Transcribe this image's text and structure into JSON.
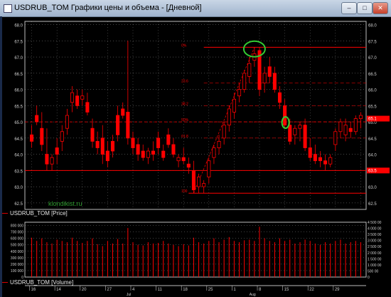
{
  "window": {
    "title": "USDRUB_TOM Графики цены и объема - [Дневной]",
    "controls": [
      "–",
      "□",
      "✕"
    ]
  },
  "price_pane": {
    "legend": "USDRUB_TOM [Price]",
    "watermark": "klondikist.ru",
    "y_ticks": [
      "68.0",
      "67.5",
      "67.0",
      "66.5",
      "66.0",
      "65.5",
      "65.0",
      "64.5",
      "64.0",
      "63.5",
      "63.0",
      "62.5"
    ],
    "fib_labels": [
      "0%",
      "23.6",
      "38.2",
      "50%",
      "61.8",
      "100"
    ],
    "right_labels": {
      "upper": "65.1",
      "lower": "63.5"
    }
  },
  "volume_pane": {
    "legend": "USDRUB_TOM [Volume]",
    "left_ticks": [
      "800 000",
      "700 000",
      "600 000",
      "500 000",
      "400 000",
      "300 000",
      "200 000",
      "100 000",
      "0"
    ],
    "right_ticks": [
      "4 500 00",
      "4 000 00",
      "3 500 00",
      "3 000 00",
      "2 500 00",
      "2 000 00",
      "1 500 00",
      "1 000 00",
      "500 00",
      "0"
    ]
  },
  "time_axis": {
    "days": [
      "16",
      "14",
      "20",
      "27",
      "4",
      "11",
      "18",
      "25",
      "1",
      "8",
      "15",
      "22",
      "29"
    ],
    "months": [
      "Jul",
      "Aug"
    ]
  },
  "colors": {
    "candle": "#ff0000",
    "grid": "#ffffff",
    "axis": "#cfcfcf",
    "highlight_circle": "#33cc33",
    "background": "#000000"
  },
  "chart_data": {
    "type": "candlestick",
    "ylim": [
      62.3,
      68.1
    ],
    "candles": [
      {
        "o": 64.6,
        "h": 64.9,
        "l": 64.2,
        "c": 64.4
      },
      {
        "o": 65.2,
        "h": 65.5,
        "l": 64.9,
        "c": 65.0
      },
      {
        "o": 64.8,
        "h": 65.3,
        "l": 64.1,
        "c": 64.3
      },
      {
        "o": 64.0,
        "h": 64.8,
        "l": 63.5,
        "c": 63.7
      },
      {
        "o": 63.7,
        "h": 64.0,
        "l": 63.5,
        "c": 63.9
      },
      {
        "o": 64.2,
        "h": 64.5,
        "l": 63.7,
        "c": 64.0
      },
      {
        "o": 64.4,
        "h": 64.9,
        "l": 64.1,
        "c": 64.7
      },
      {
        "o": 64.8,
        "h": 65.4,
        "l": 64.6,
        "c": 65.2
      },
      {
        "o": 65.6,
        "h": 66.1,
        "l": 65.3,
        "c": 65.9
      },
      {
        "o": 65.8,
        "h": 66.0,
        "l": 65.4,
        "c": 65.5
      },
      {
        "o": 65.7,
        "h": 66.0,
        "l": 65.5,
        "c": 65.8
      },
      {
        "o": 65.6,
        "h": 65.9,
        "l": 65.2,
        "c": 65.3
      },
      {
        "o": 64.8,
        "h": 65.1,
        "l": 64.2,
        "c": 64.4
      },
      {
        "o": 64.4,
        "h": 64.7,
        "l": 64.0,
        "c": 64.2
      },
      {
        "o": 64.5,
        "h": 64.9,
        "l": 63.7,
        "c": 64.0
      },
      {
        "o": 64.1,
        "h": 64.4,
        "l": 63.6,
        "c": 63.8
      },
      {
        "o": 64.4,
        "h": 64.6,
        "l": 63.9,
        "c": 64.1
      },
      {
        "o": 65.2,
        "h": 65.5,
        "l": 64.4,
        "c": 64.6
      },
      {
        "o": 65.4,
        "h": 65.6,
        "l": 65.1,
        "c": 65.2
      },
      {
        "o": 65.3,
        "h": 67.5,
        "l": 64.3,
        "c": 64.5
      },
      {
        "o": 64.5,
        "h": 64.7,
        "l": 64.0,
        "c": 64.2
      },
      {
        "o": 64.3,
        "h": 64.5,
        "l": 63.8,
        "c": 64.0
      },
      {
        "o": 64.1,
        "h": 64.3,
        "l": 63.8,
        "c": 63.9
      },
      {
        "o": 63.9,
        "h": 64.2,
        "l": 63.7,
        "c": 64.1
      },
      {
        "o": 64.1,
        "h": 64.4,
        "l": 63.8,
        "c": 64.0
      },
      {
        "o": 64.5,
        "h": 64.7,
        "l": 64.0,
        "c": 64.2
      },
      {
        "o": 64.1,
        "h": 64.3,
        "l": 63.8,
        "c": 63.9
      },
      {
        "o": 64.6,
        "h": 64.8,
        "l": 64.2,
        "c": 64.3
      },
      {
        "o": 64.3,
        "h": 64.5,
        "l": 63.9,
        "c": 64.0
      },
      {
        "o": 63.8,
        "h": 64.0,
        "l": 63.6,
        "c": 63.9
      },
      {
        "o": 63.9,
        "h": 64.2,
        "l": 63.7,
        "c": 63.8
      },
      {
        "o": 63.7,
        "h": 63.9,
        "l": 63.4,
        "c": 63.6
      },
      {
        "o": 63.5,
        "h": 63.8,
        "l": 62.8,
        "c": 62.9
      },
      {
        "o": 63.0,
        "h": 63.4,
        "l": 62.8,
        "c": 63.3
      },
      {
        "o": 63.0,
        "h": 63.2,
        "l": 62.8,
        "c": 63.1
      },
      {
        "o": 63.3,
        "h": 63.9,
        "l": 63.1,
        "c": 63.8
      },
      {
        "o": 63.9,
        "h": 64.3,
        "l": 63.7,
        "c": 64.2
      },
      {
        "o": 64.2,
        "h": 64.6,
        "l": 64.0,
        "c": 64.4
      },
      {
        "o": 64.5,
        "h": 65.0,
        "l": 64.3,
        "c": 64.9
      },
      {
        "o": 64.9,
        "h": 65.5,
        "l": 64.7,
        "c": 65.4
      },
      {
        "o": 65.3,
        "h": 65.9,
        "l": 65.1,
        "c": 65.7
      },
      {
        "o": 65.8,
        "h": 66.2,
        "l": 65.6,
        "c": 66.0
      },
      {
        "o": 66.0,
        "h": 66.6,
        "l": 65.9,
        "c": 66.5
      },
      {
        "o": 66.4,
        "h": 67.0,
        "l": 66.2,
        "c": 66.8
      },
      {
        "o": 66.9,
        "h": 67.3,
        "l": 66.7,
        "c": 67.1
      },
      {
        "o": 67.2,
        "h": 67.3,
        "l": 65.8,
        "c": 66.0
      },
      {
        "o": 66.2,
        "h": 66.7,
        "l": 65.9,
        "c": 66.5
      },
      {
        "o": 66.7,
        "h": 67.0,
        "l": 66.2,
        "c": 66.4
      },
      {
        "o": 66.5,
        "h": 66.7,
        "l": 65.9,
        "c": 66.0
      },
      {
        "o": 65.9,
        "h": 66.1,
        "l": 65.4,
        "c": 65.6
      },
      {
        "o": 65.5,
        "h": 65.7,
        "l": 64.8,
        "c": 64.9
      },
      {
        "o": 64.9,
        "h": 65.1,
        "l": 64.3,
        "c": 64.4
      },
      {
        "o": 64.6,
        "h": 64.9,
        "l": 64.3,
        "c": 64.8
      },
      {
        "o": 64.8,
        "h": 65.0,
        "l": 64.4,
        "c": 64.9
      },
      {
        "o": 64.9,
        "h": 65.1,
        "l": 64.1,
        "c": 64.2
      },
      {
        "o": 64.2,
        "h": 64.5,
        "l": 63.8,
        "c": 63.9
      },
      {
        "o": 64.0,
        "h": 64.3,
        "l": 63.7,
        "c": 63.8
      },
      {
        "o": 63.9,
        "h": 64.1,
        "l": 63.6,
        "c": 63.8
      },
      {
        "o": 63.8,
        "h": 64.0,
        "l": 63.5,
        "c": 63.7
      },
      {
        "o": 63.7,
        "h": 64.0,
        "l": 63.6,
        "c": 63.9
      },
      {
        "o": 64.3,
        "h": 64.8,
        "l": 64.1,
        "c": 64.7
      },
      {
        "o": 64.7,
        "h": 65.1,
        "l": 64.5,
        "c": 65.0
      },
      {
        "o": 64.6,
        "h": 65.1,
        "l": 64.4,
        "c": 64.9
      },
      {
        "o": 64.8,
        "h": 65.0,
        "l": 64.5,
        "c": 64.7
      },
      {
        "o": 64.7,
        "h": 65.2,
        "l": 64.6,
        "c": 65.1
      },
      {
        "o": 65.1,
        "h": 65.3,
        "l": 64.8,
        "c": 65.2
      }
    ],
    "horizontal_levels": [
      67.3,
      65.0,
      63.5,
      62.8
    ],
    "fib_levels": [
      {
        "label": "0%",
        "value": 67.3
      },
      {
        "label": "23.6",
        "value": 66.2
      },
      {
        "label": "38.2",
        "value": 65.5
      },
      {
        "label": "50%",
        "value": 65.0
      },
      {
        "label": "61.8",
        "value": 64.5
      },
      {
        "label": "100",
        "value": 62.8
      }
    ],
    "volume_ylim": [
      0,
      850000
    ],
    "volumes": [
      610000,
      560000,
      600000,
      540000,
      520000,
      580000,
      560000,
      540000,
      610000,
      560000,
      530000,
      560000,
      600000,
      510000,
      480000,
      560000,
      520000,
      590000,
      520000,
      760000,
      540000,
      500000,
      490000,
      540000,
      520000,
      530000,
      560000,
      520000,
      500000,
      480000,
      510000,
      490000,
      610000,
      540000,
      520000,
      560000,
      600000,
      540000,
      580000,
      620000,
      560000,
      540000,
      570000,
      580000,
      560000,
      780000,
      600000,
      560000,
      540000,
      600000,
      560000,
      580000,
      520000,
      540000,
      580000,
      560000,
      520000,
      500000,
      540000,
      520000,
      560000,
      580000,
      520000,
      540000,
      560000,
      540000
    ]
  }
}
